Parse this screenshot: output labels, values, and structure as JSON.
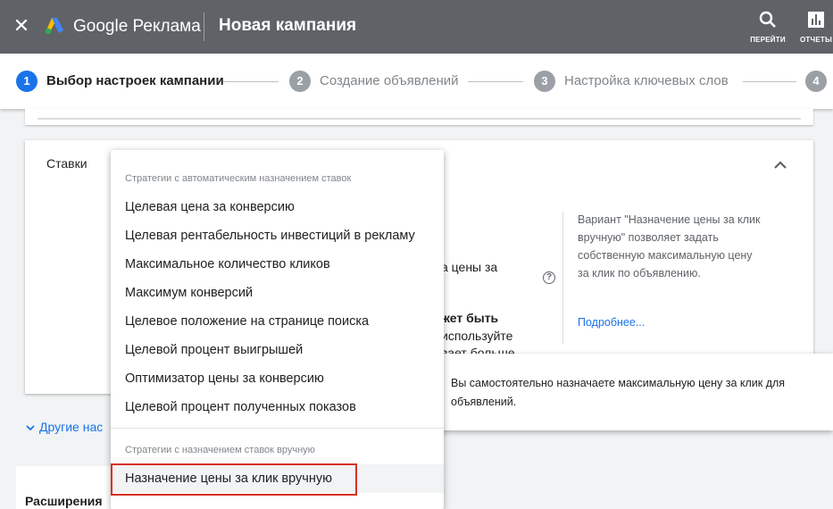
{
  "topbar": {
    "close_icon": "close-icon",
    "brand": "Google Реклама",
    "title": "Новая кампания",
    "goto_label": "ПЕРЕЙТИ",
    "reports_label": "ОТЧЕТЫ",
    "bg_color": "#5f6368"
  },
  "stepper": {
    "steps": [
      {
        "num": "1",
        "label": "Выбор настроек кампании",
        "active": true
      },
      {
        "num": "2",
        "label": "Создание объявлений",
        "active": false
      },
      {
        "num": "3",
        "label": "Настройка ключевых слов",
        "active": false
      },
      {
        "num": "4",
        "label": "",
        "active": false
      }
    ],
    "active_color": "#1a73e8",
    "inactive_color": "#9aa0a6"
  },
  "bids": {
    "title": "Ставки",
    "fragments": {
      "f1": "а цены за",
      "f2": "жет быть",
      "f3": "используйте",
      "f4": "вает больше"
    },
    "side_text": "Вариант \"Назначение цены за клик вручную\" позволяет задать собственную максимальную цену за клик по объявлению.",
    "side_link": "Подробнее..."
  },
  "other_settings": "Другие нас",
  "extensions": "Расширения",
  "tooltip": "Вы самостоятельно назначаете максимальную цену за клик для объявлений.",
  "menu": {
    "auto_header": "Стратегии с автоматическим назначением ставок",
    "auto_items": [
      "Целевая цена за конверсию",
      "Целевая рентабельность инвестиций в рекламу",
      "Максимальное количество кликов",
      "Максимум конверсий",
      "Целевое положение на странице поиска",
      "Целевой процент выигрышей",
      "Оптимизатор цены за конверсию",
      "Целевой процент полученных показов"
    ],
    "manual_header": "Стратегии с назначением ставок вручную",
    "manual_item": "Назначение цены за клик вручную",
    "highlight_color": "#d93025"
  }
}
